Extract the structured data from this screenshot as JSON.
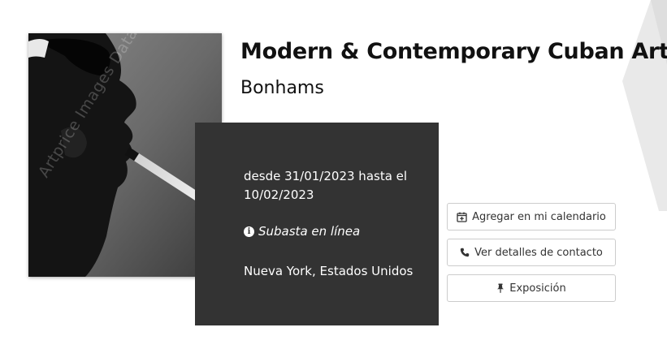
{
  "auction": {
    "title": "Modern & Contemporary Cuban Art",
    "house": "Bonhams",
    "dates": "desde 31/01/2023 hasta el 10/02/2023",
    "type": "Subasta en línea",
    "location": "Nueva York, Estados Unidos"
  },
  "artwork": {
    "watermark": "Artprice Images Database"
  },
  "actions": {
    "calendar_label": "Agregar en mi calendario",
    "contact_label": "Ver detalles de contacto",
    "exhibition_label": "Exposición"
  },
  "icons": {
    "calendar": "calendar-plus-icon",
    "contact": "phone-icon",
    "exhibition": "pin-icon",
    "info": "info-circle-icon"
  },
  "colors": {
    "info_box_bg": "#333333",
    "button_border": "#cccccc",
    "title": "#111111"
  }
}
